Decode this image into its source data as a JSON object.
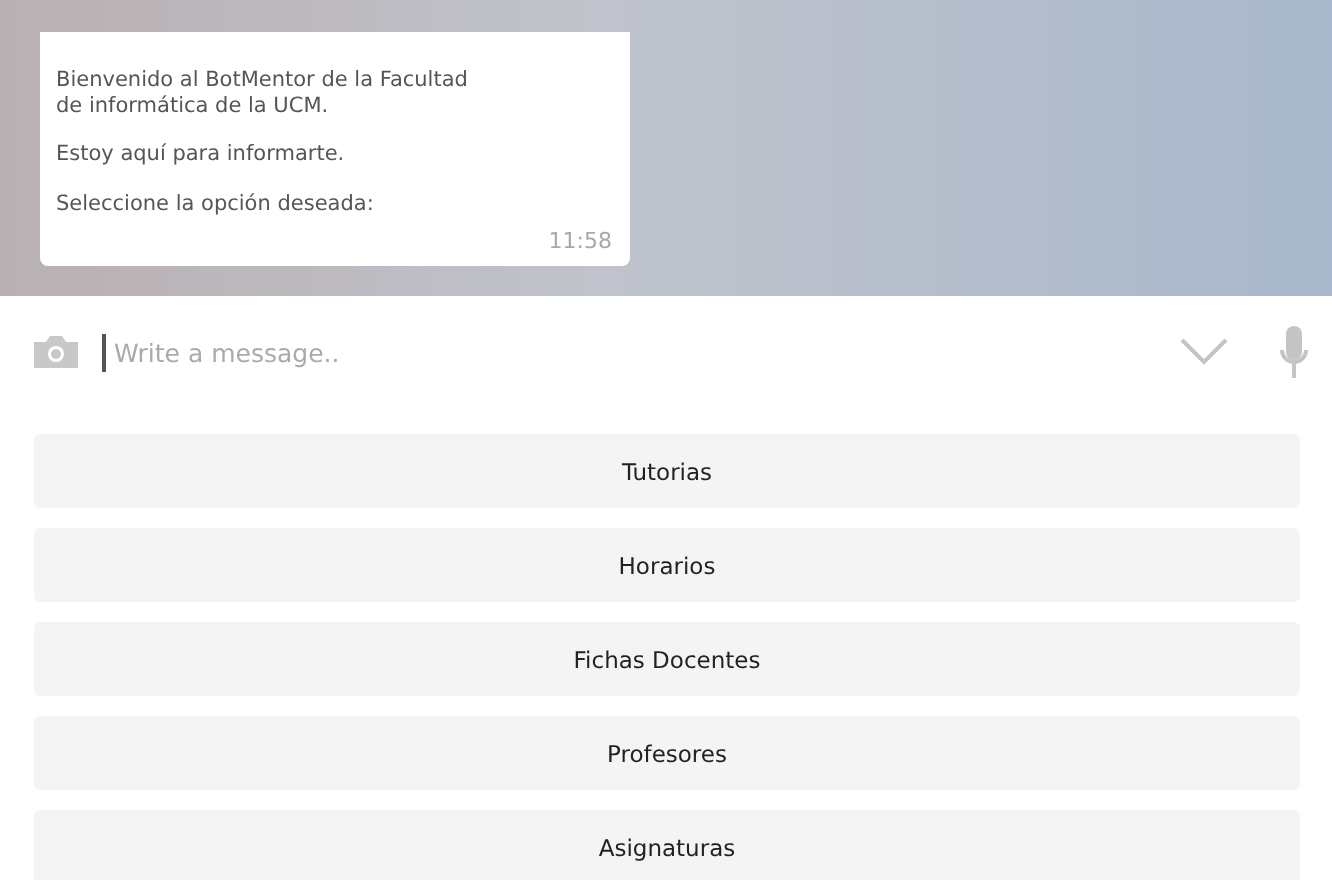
{
  "message": {
    "paragraphs": [
      "Bienvenido al BotMentor de la Facultad\nde informática de la UCM.",
      "Estoy aquí para informarte.",
      "Seleccione la opción deseada:"
    ],
    "time": "11:58"
  },
  "composer": {
    "placeholder": "Write a message.."
  },
  "options": [
    "Tutorias",
    "Horarios",
    "Fichas Docentes",
    "Profesores",
    "Asignaturas"
  ]
}
